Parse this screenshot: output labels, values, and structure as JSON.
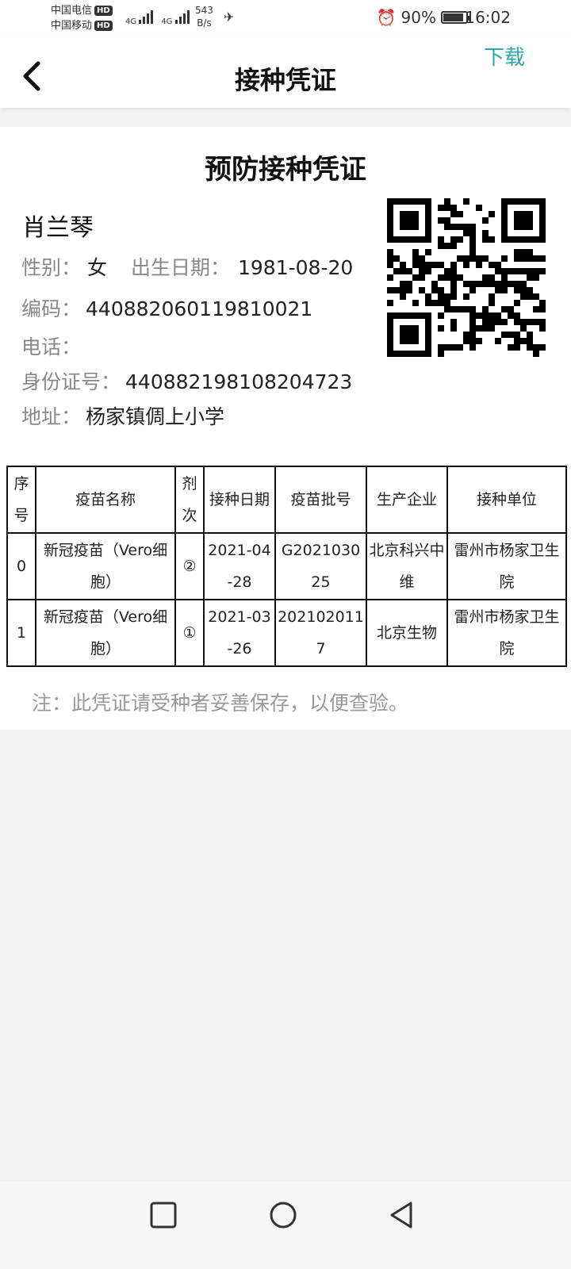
{
  "status_bar": {
    "carrier_1": "中国电信",
    "carrier_2": "中国移动",
    "hd_label": "HD",
    "network_1": "4G",
    "network_2": "4G",
    "net_speed_value": "543",
    "net_speed_unit": "B/s",
    "battery": "90%",
    "battery_level": 0.9,
    "time": "16:02"
  },
  "header": {
    "title": "接种凭证",
    "download_label": "下载"
  },
  "certificate": {
    "title": "预防接种凭证",
    "name": "肖兰琴",
    "gender_label": "性别：",
    "gender": "女",
    "birth_label": "出生日期：",
    "birth_date": "1981-08-20",
    "code_label": "编码：",
    "code": "440882060119810021",
    "phone_label": "电话：",
    "phone": "",
    "id_label": "身份证号：",
    "id_number": "440882198108204723",
    "address_label": "地址：",
    "address": "杨家镇倜上小学"
  },
  "table": {
    "headers": [
      "序号",
      "疫苗名称",
      "剂次",
      "接种日期",
      "疫苗批号",
      "生产企业",
      "接种单位"
    ],
    "rows": [
      [
        "0",
        "新冠疫苗（Vero细胞）",
        "②",
        "2021-04-28",
        "G202103025",
        "北京科兴中维",
        "雷州市杨家卫生院"
      ],
      [
        "1",
        "新冠疫苗（Vero细胞）",
        "①",
        "2021-03-26",
        "2021020117",
        "北京生物",
        "雷州市杨家卫生院"
      ]
    ]
  },
  "note": "注：此凭证请受种者妥善保存，以便查验。",
  "colors": {
    "accent": "#2aa8a3",
    "label_gray": "#888888",
    "background": "#f2f2f2"
  }
}
